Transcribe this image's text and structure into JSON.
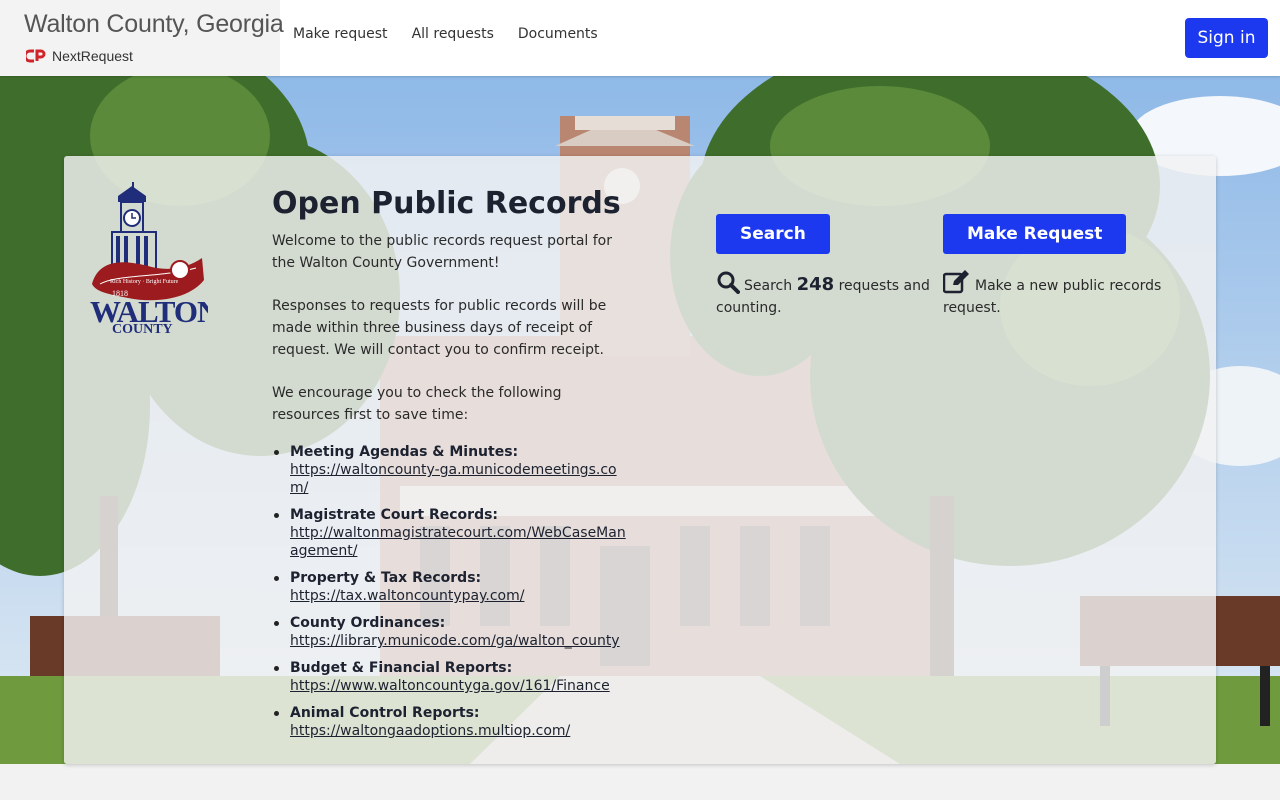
{
  "header": {
    "site_title": "Walton County, Georgia",
    "powered_by": "NextRequest",
    "nav": [
      "Make request",
      "All requests",
      "Documents"
    ],
    "sign_in": "Sign in"
  },
  "seal": {
    "text": "WALTON COUNTY",
    "motto": "Rich History · Bright Future",
    "year": "1818"
  },
  "main": {
    "title": "Open Public Records",
    "intro_paragraphs": [
      "Welcome to the public records request portal for the Walton County Government!",
      "Responses to requests for public records will be made within three business days of receipt of request. We will contact you to confirm receipt.",
      "We encourage you to check the following resources first to save time:"
    ],
    "resources": [
      {
        "title": "Meeting Agendas & Minutes:",
        "link": "https://waltoncounty-ga.municodemeetings.com/"
      },
      {
        "title": "Magistrate Court Records:",
        "link": "http://waltonmagistratecourt.com/WebCaseManagement/"
      },
      {
        "title": "Property & Tax Records:",
        "link": "https://tax.waltoncountypay.com/"
      },
      {
        "title": "County Ordinances:",
        "link": "https://library.municode.com/ga/walton_county"
      },
      {
        "title": "Budget & Financial Reports:",
        "link": "https://www.waltoncountyga.gov/161/Finance"
      },
      {
        "title": "Animal Control Reports:",
        "link": "https://waltongaadoptions.multiop.com/"
      }
    ]
  },
  "search_action": {
    "button": "Search",
    "prefix": "Search",
    "count": "248",
    "suffix": "requests and counting."
  },
  "request_action": {
    "button": "Make Request",
    "description": "Make a new public records request."
  },
  "icons": {
    "search": "search-icon",
    "request": "edit-icon",
    "brand": "nextrequest-logo-icon"
  },
  "colors": {
    "primary": "#1d39f0",
    "heading": "#1d2230",
    "seal_blue": "#1f2d7a",
    "seal_red": "#9b1b1e"
  }
}
